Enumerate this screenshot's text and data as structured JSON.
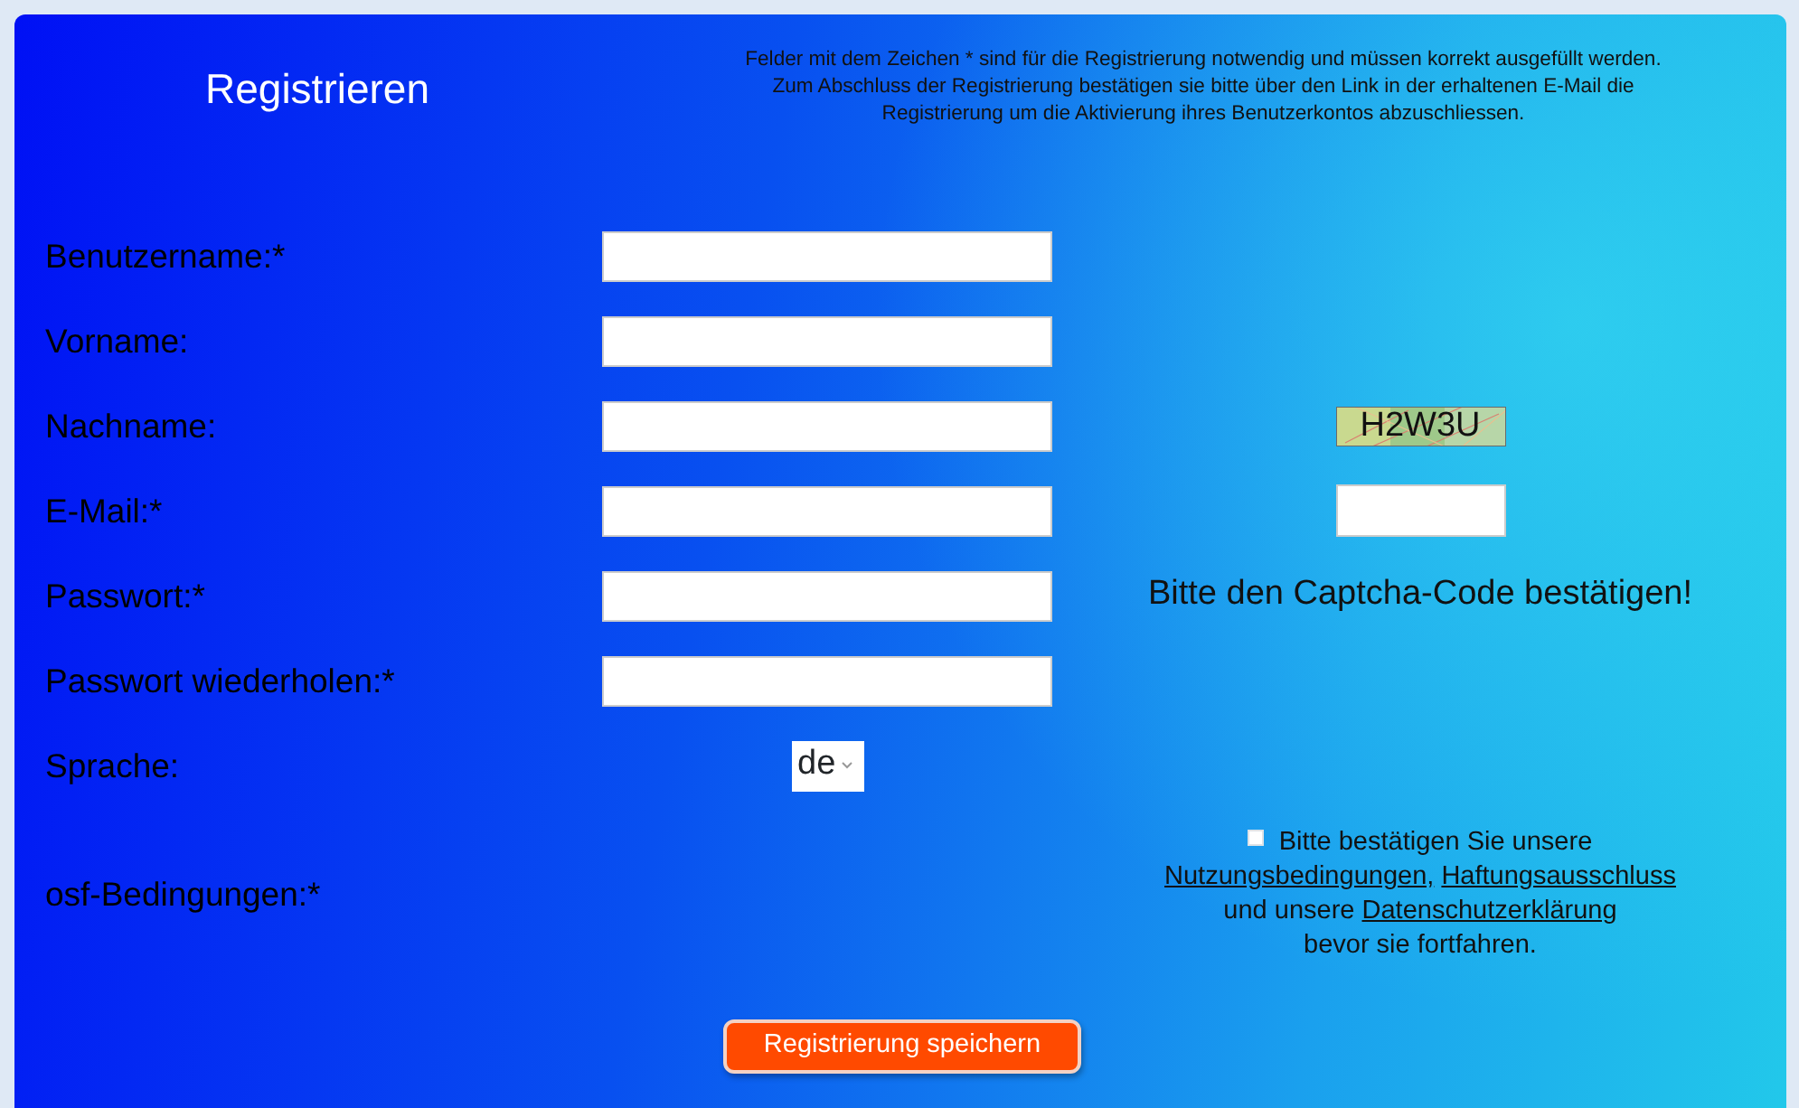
{
  "header": {
    "title": "Registrieren",
    "notice_lines": [
      "Felder mit dem Zeichen * sind für die Registrierung notwendig und müssen korrekt ausgefüllt werden.",
      "Zum Abschluss der Registrierung bestätigen sie bitte über den Link in der erhaltenen E-Mail die",
      "Registrierung um die Aktivierung ihres Benutzerkontos abzuschliessen."
    ]
  },
  "fields": [
    {
      "kind": "text",
      "label": "Benutzername:*"
    },
    {
      "kind": "text",
      "label": "Vorname:"
    },
    {
      "kind": "text",
      "label": "Nachname:"
    },
    {
      "kind": "text",
      "label": "E-Mail:*"
    },
    {
      "kind": "password",
      "label": "Passwort:*"
    },
    {
      "kind": "password",
      "label": "Passwort wiederholen:*"
    },
    {
      "kind": "select",
      "label": "Sprache:",
      "value": "de"
    },
    {
      "kind": "consent",
      "label": "osf-Bedingungen:*"
    }
  ],
  "captcha": {
    "code": "H2W3U",
    "prompt": "Bitte den Captcha-Code bestätigen!"
  },
  "consent": {
    "checked": false,
    "lines": [
      [
        {
          "text": "Bitte bestätigen Sie unsere",
          "link": false
        }
      ],
      [
        {
          "text": "Nutzungsbedingungen,",
          "link": true
        },
        {
          "text": "Haftungsausschluss",
          "link": true
        }
      ],
      [
        {
          "text": "und unsere",
          "link": false
        },
        {
          "text": "Datenschutzerklärung",
          "link": true
        }
      ],
      [
        {
          "text": "bevor sie fortfahren.",
          "link": false
        }
      ]
    ]
  },
  "submit": {
    "label": "Registrierung speichern"
  }
}
